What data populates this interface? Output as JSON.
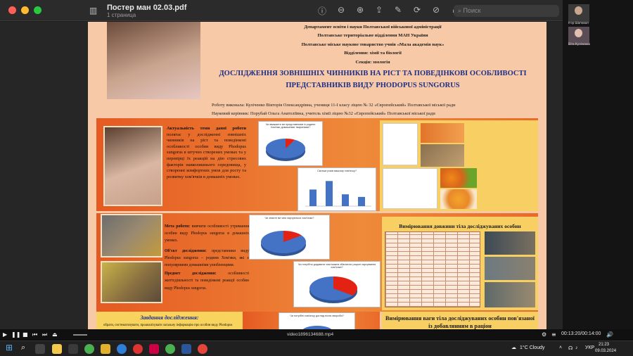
{
  "app": {
    "title": "Постер ман 02.03.pdf",
    "subtitle": "1 страница",
    "search_placeholder": "Поиск"
  },
  "participants": [
    {
      "name": "Ігор Шаповал"
    },
    {
      "name": "Віта Куліченко"
    }
  ],
  "poster": {
    "header_lines": [
      "Департамент освіти і науки Полтавської військової адміністрації",
      "Полтавське територіальне відділення МАН України",
      "Полтавське міське наукове товариство учнів «Мала академія наук»",
      "Відділення: хімії та біології",
      "Секція: зоологія"
    ],
    "title_line1": "ДОСЛІДЖЕННЯ ЗОВНІШНІХ ЧИННИКІВ НА РІСТ ТА ПОВЕДІНКОВІ ОСОБЛИВОСТІ",
    "title_line2": "ПРЕДСТАВНИКІВ ВИДУ PHODOPUS SUNGORUS",
    "author": "Роботу виконала: Куліченко Вікторія Олександрівна, учениця 11-І класу ліцею № 32 «Європейський» Полтавської міської ради",
    "supervisor": "Науковий керівник: Порубай Ольга Анатоліївна, учитель хімії ліцею №32 «Європейський» Полтавської міської ради",
    "relevance_head": "Актуальність теми даної роботи",
    "relevance_body": "полягає у дослідженні зовнішніх чинників на ріст та поведінкові особливості особин виду Phodopus sungorus в штучно створених умовах та у перевірці їх реакцій на дію стресових факторів навколишнього середовища, у створенні комфортних умов для росту та розвитку хом'ячків в домашніх умовах.",
    "goal_head": "Мета роботи:",
    "goal_body": "вивчити особливості утримання особин виду Phodopus sungorus в домашніх умовах.",
    "object_head": "Об'єкт дослідження:",
    "object_body": "представники виду Phodopus sungorus – родини Хом'яки, які є популярними домашніми улюбленцями.",
    "subject_head": "Предмет дослідження:",
    "subject_body": "особливості життєдіяльності та поведінкові реакції особин виду Phodopus sungorus.",
    "tasks_head": "Завдання дослідження:",
    "tasks_body": "обрати, систематизувати, проаналізувати загальну інформацію про особин виду Phodopus",
    "length_table_title": "Вимірювання довжини тіла досліджуваних особин",
    "weight_title": "Вимірювання ваги тіла досліджуваних особин пов'язаної із добавлянням в раціон"
  },
  "charts": {
    "pie1": {
      "title": "Чи вважаєте ви представників із родини Хом'яки домашніми тваринами?"
    },
    "bar1": {
      "title": "Скільки років вашому хом'ячку?"
    },
    "pie2": {
      "title": "Чи знаєте ви чим харчуються хом'ячки?"
    },
    "pie3": {
      "title": "Чи потрібно додавати чим можна збагатити раціон харчування хом'ячка?"
    },
    "pie4": {
      "title": "Чи потрібні хом'ячку догляд після хвороби?"
    }
  },
  "chart_data": [
    {
      "type": "pie",
      "title": "Чи вважаєте ви представників із родини Хом'яки домашніми тваринами?",
      "values": [
        8,
        92
      ]
    },
    {
      "type": "bar",
      "title": "Скільки років вашому хом'ячку?",
      "categories": [
        "1",
        "2",
        "3",
        "4"
      ],
      "values": [
        45,
        68,
        32,
        25
      ]
    },
    {
      "type": "pie",
      "title": "Чи знаєте ви чим харчуються хом'ячки?",
      "values": [
        15,
        85
      ]
    },
    {
      "type": "pie",
      "title": "Чи потрібно додавати чим можна збагатити раціон харчування хом'ячка?",
      "values": [
        35,
        65
      ]
    }
  ],
  "video": {
    "filename": "video1896134688.mp4",
    "time": "00:13:20/00:14:00"
  },
  "taskbar": {
    "weather": "1°C Cloudy",
    "lang": "УКР",
    "time": "21:23",
    "date": "09.03.2024"
  },
  "colors": {
    "pie_blue": "#4472c4",
    "pie_red": "#e32214",
    "title_blue": "#1d2f8a"
  }
}
